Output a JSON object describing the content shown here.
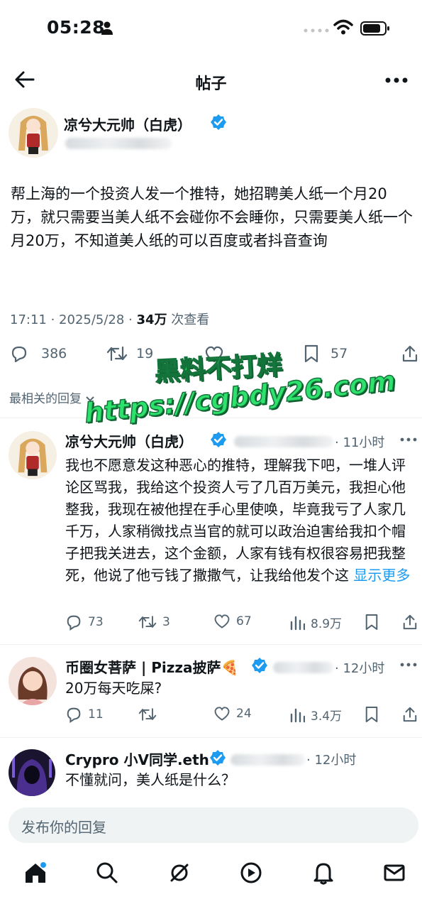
{
  "status_bar": {
    "time": "05:28"
  },
  "header": {
    "title": "帖子"
  },
  "main_post": {
    "author": "凉兮大元帅（白虎）",
    "text": "帮上海的一个投资人发一个推特，她招聘美人纸一个月20万，就只需要当美人纸不会碰你不会睡你，只需要美人纸一个月20万，不知道美人纸的可以百度或者抖音查询",
    "time": "17:11 · 2025/5/28 · ",
    "views_count": "34万",
    "views_suffix": " 次查看",
    "replies": "386",
    "reposts": "19",
    "bookmarks": "57"
  },
  "sort_label": "最相关的回复",
  "watermark": {
    "line1": "黑料不打烊",
    "line2": "https://cgbdy26.com"
  },
  "replies": [
    {
      "author": "凉兮大元帅（白虎）",
      "time": "· 11小时",
      "text": "我也不愿意发这种恶心的推特，理解我下吧，一堆人评论区骂我，我给这个投资人亏了几百万美元，我担心他整我，我现在被他捏在手心里使唤，毕竟我亏了人家几千万，人家稍微找点当官的就可以政治迫害给我扣个帽子把我关进去，这个金额，人家有钱有权很容易把我整死，他说了他亏钱了撒撒气，让我给他发个这",
      "show_more": "显示更多",
      "replies": "73",
      "reposts": "3",
      "likes": "67",
      "views": "8.9万"
    },
    {
      "author": "币圈女菩萨 | Pizza披萨🍕",
      "time": "· 12小时",
      "text": "20万每天吃屎?",
      "replies": "11",
      "reposts": "",
      "likes": "24",
      "views": "3.4万"
    },
    {
      "author": "Crypro 小V同学.eth",
      "time": "· 12小时",
      "text": "不懂就问，美人纸是什么？"
    }
  ],
  "reply_box": {
    "placeholder": "发布你的回复"
  },
  "colors": {
    "accent": "#1d9bf0",
    "verified": "#1d9bf0",
    "watermark": "#2ee06c"
  },
  "nav": [
    "home-icon",
    "search-icon",
    "grok-icon",
    "video-icon",
    "notifications-icon",
    "messages-icon"
  ]
}
